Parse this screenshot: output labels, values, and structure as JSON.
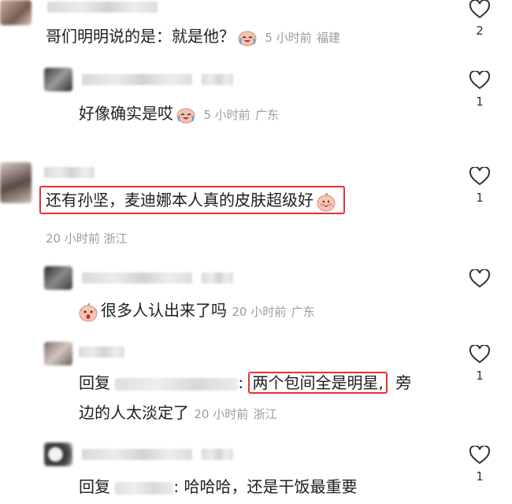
{
  "comments": [
    {
      "text": "哥们明明说的是：就是他？",
      "time": "5 小时前",
      "location": "福建",
      "likes": "2",
      "emoji": "crying-laughing-face"
    },
    {
      "text": "好像确实是哎",
      "time": "5 小时前",
      "location": "广东",
      "likes": "1",
      "emoji": "crying-laughing-face"
    },
    {
      "text": "还有孙坚，麦迪娜本人真的皮肤超级好",
      "time": "20 小时前",
      "location": "浙江",
      "likes": "1",
      "emoji": "blushing-peach-face",
      "highlight_color": "#e8322e"
    },
    {
      "text": "很多人认出来了吗",
      "time": "20 小时前",
      "location": "广东",
      "likes": "",
      "emoji": "shocked-peach-face"
    },
    {
      "reply_prefix": "回复",
      "separator": ":",
      "text_highlight": "两个包间全是明星,",
      "text_rest_1": "旁",
      "text_rest_2": "边的人太淡定了",
      "time": "20 小时前",
      "location": "浙江",
      "likes": "1"
    },
    {
      "reply_prefix": "回复",
      "text": ": 哈哈哈，还是干饭最重要",
      "likes": "1"
    }
  ]
}
